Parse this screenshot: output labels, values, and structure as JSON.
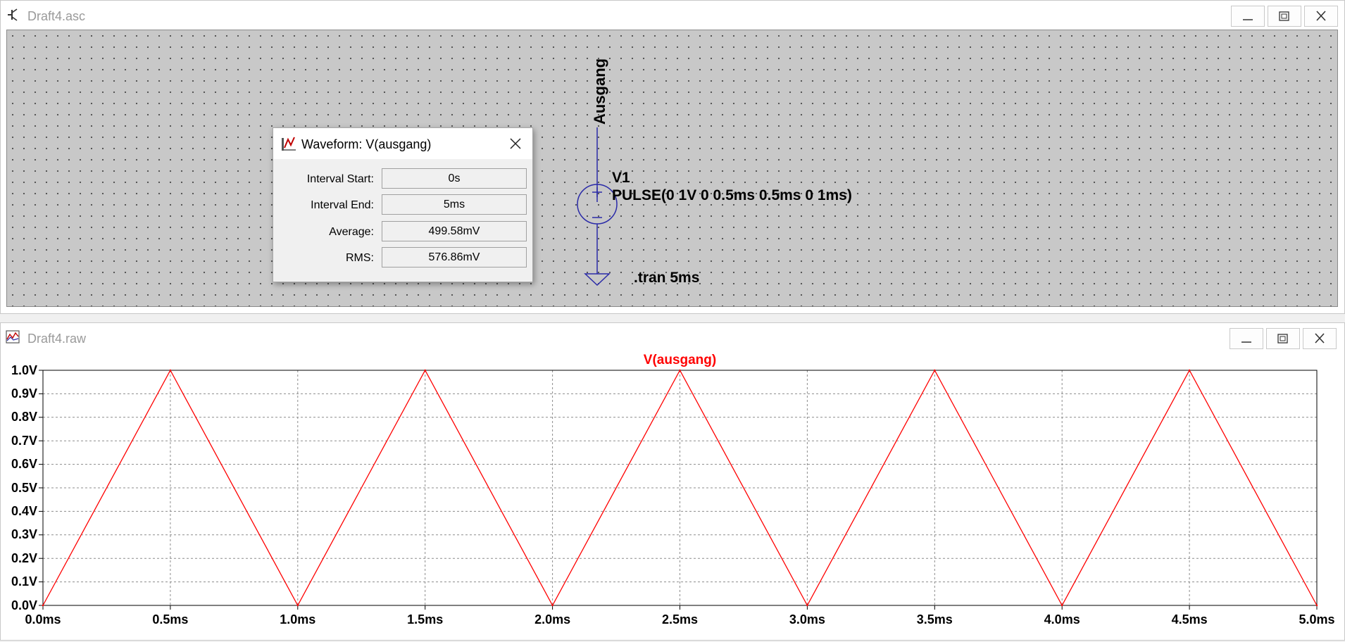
{
  "schematic_window": {
    "title": "Draft4.asc",
    "net_label": "Ausgang",
    "source_name": "V1",
    "source_value": "PULSE(0 1V 0 0.5ms 0.5ms 0 1ms)",
    "directive": ".tran 5ms"
  },
  "waveform_dialog": {
    "title": "Waveform: V(ausgang)",
    "close_icon": "close-icon",
    "rows": [
      {
        "label": "Interval Start:",
        "value": "0s"
      },
      {
        "label": "Interval End:",
        "value": "5ms"
      },
      {
        "label": "Average:",
        "value": "499.58mV"
      },
      {
        "label": "RMS:",
        "value": "576.86mV"
      }
    ]
  },
  "waveform_window": {
    "title": "Draft4.raw"
  },
  "window_controls": [
    "minimize-icon",
    "maximize-icon",
    "close-icon"
  ],
  "colors": {
    "trace": "#ff0000",
    "wire": "#2a2aa8",
    "schematic_bg": "#c8c8c8"
  },
  "chart_data": {
    "type": "line",
    "title": "V(ausgang)",
    "xlim": [
      0,
      5
    ],
    "ylim": [
      0,
      1
    ],
    "x_ticks": [
      "0.0ms",
      "0.5ms",
      "1.0ms",
      "1.5ms",
      "2.0ms",
      "2.5ms",
      "3.0ms",
      "3.5ms",
      "4.0ms",
      "4.5ms",
      "5.0ms"
    ],
    "y_ticks": [
      "0.0V",
      "0.1V",
      "0.2V",
      "0.3V",
      "0.4V",
      "0.5V",
      "0.6V",
      "0.7V",
      "0.8V",
      "0.9V",
      "1.0V"
    ],
    "grid": true,
    "series": [
      {
        "name": "V(ausgang)",
        "color": "#ff0000",
        "x": [
          0,
          0.5,
          1.0,
          1.5,
          2.0,
          2.5,
          3.0,
          3.5,
          4.0,
          4.5,
          5.0
        ],
        "y": [
          0,
          1,
          0,
          1,
          0,
          1,
          0,
          1,
          0,
          1,
          0
        ]
      }
    ]
  }
}
